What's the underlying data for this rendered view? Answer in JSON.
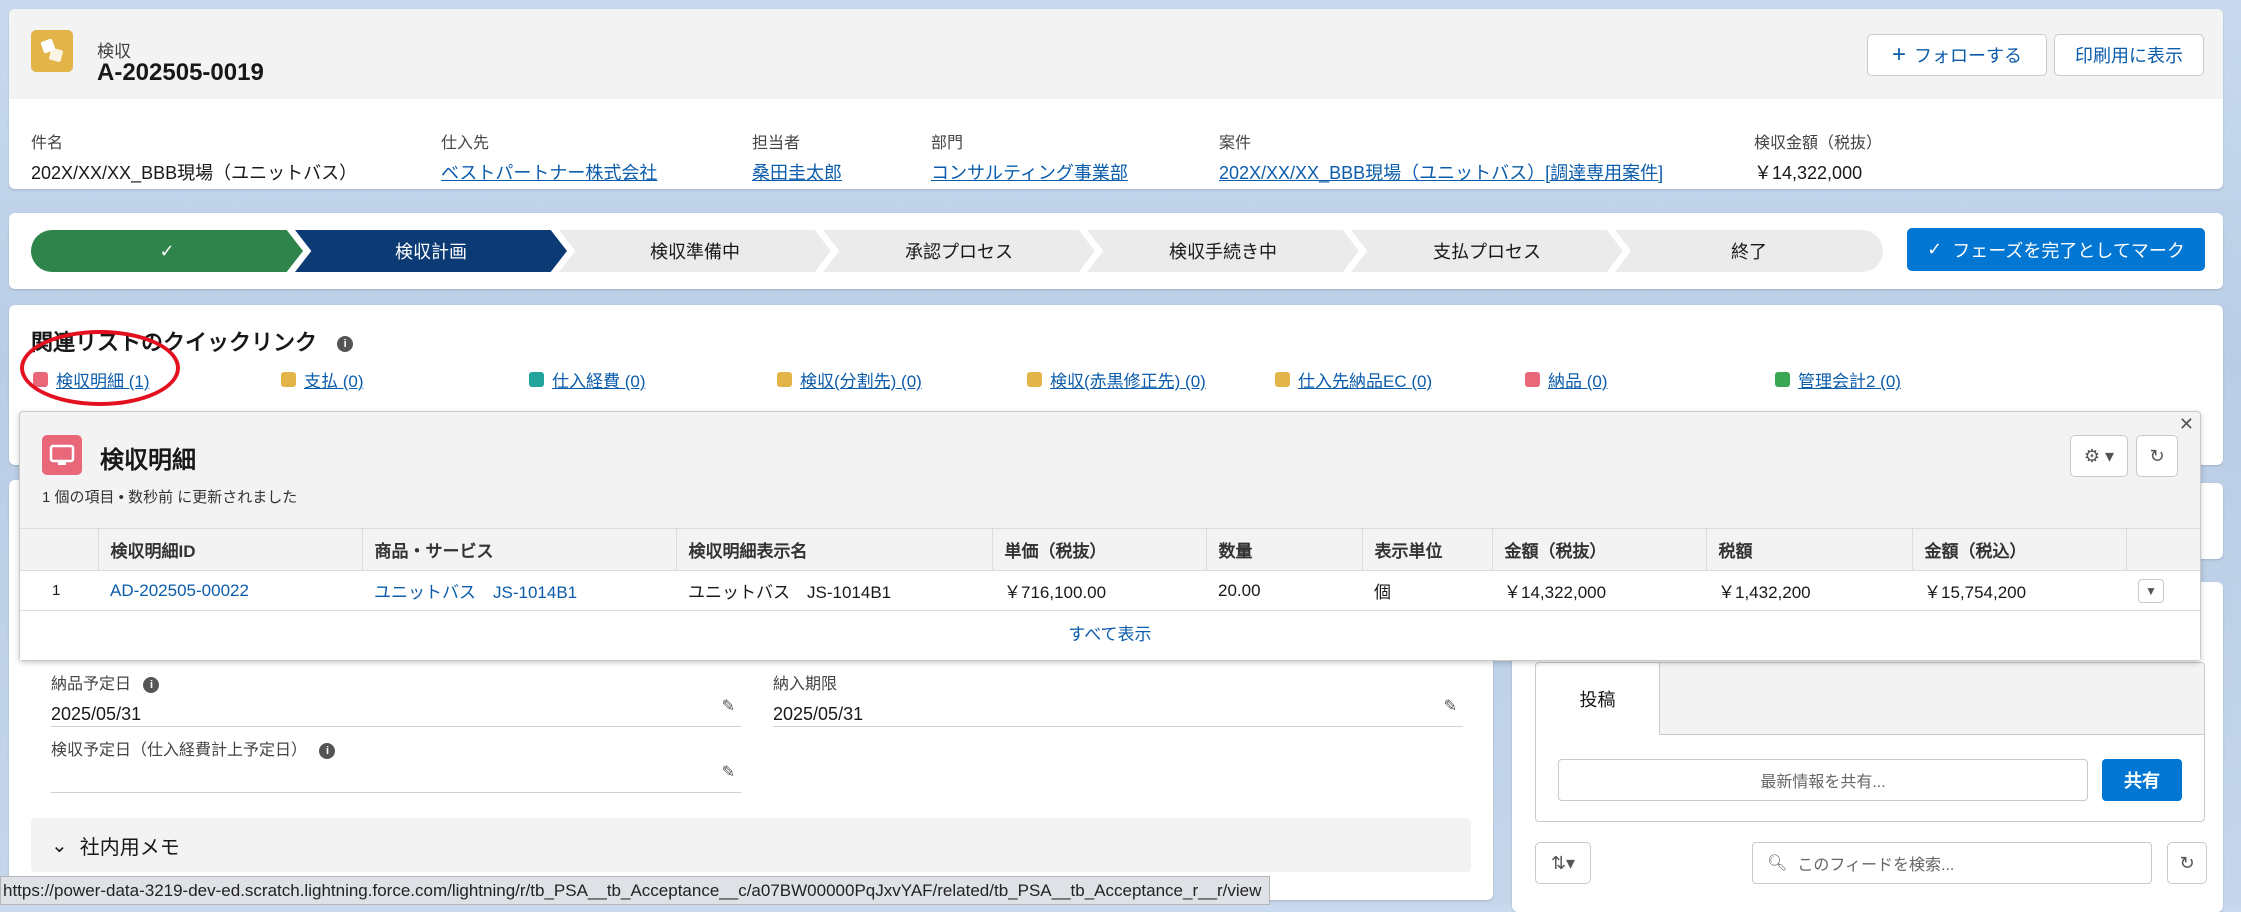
{
  "header": {
    "object_label": "検収",
    "record_name": "A-202505-0019",
    "follow_label": "フォローする",
    "print_label": "印刷用に表示",
    "fields": [
      {
        "label": "件名",
        "value": "202X/XX/XX_BBB現場（ユニットバス）",
        "link": false
      },
      {
        "label": "仕入先",
        "value": "ベストパートナー株式会社",
        "link": true
      },
      {
        "label": "担当者",
        "value": "桑田圭太郎",
        "link": true
      },
      {
        "label": "部門",
        "value": "コンサルティング事業部",
        "link": true
      },
      {
        "label": "案件",
        "value": "202X/XX/XX_BBB現場（ユニットバス）[調達専用案件]",
        "link": true
      },
      {
        "label": "検収金額（税抜）",
        "value": "￥14,322,000",
        "link": false
      }
    ]
  },
  "path": {
    "steps": [
      "✓",
      "検収計画",
      "検収準備中",
      "承認プロセス",
      "検収手続き中",
      "支払プロセス",
      "終了"
    ],
    "mark_label": "フェーズを完了としてマーク"
  },
  "quick_links": {
    "title": "関連リストのクイックリンク",
    "items": [
      {
        "label": "検収明細 (1)",
        "color": "#e8687a"
      },
      {
        "label": "支払 (0)",
        "color": "#e3b447"
      },
      {
        "label": "仕入経費 (0)",
        "color": "#22a39b"
      },
      {
        "label": "検収(分割先) (0)",
        "color": "#e3b447"
      },
      {
        "label": "検収(赤黒修正先) (0)",
        "color": "#e3b447"
      },
      {
        "label": "仕入先納品EC (0)",
        "color": "#e3b447"
      },
      {
        "label": "納品 (0)",
        "color": "#e8687a"
      },
      {
        "label": "管理会計2 (0)",
        "color": "#3ba755"
      }
    ]
  },
  "popover": {
    "title": "検収明細",
    "subtitle": "1 個の項目 • 数秒前 に更新されました",
    "columns": [
      "",
      "検収明細ID",
      "商品・サービス",
      "検収明細表示名",
      "単価（税抜）",
      "数量",
      "表示単位",
      "金額（税抜）",
      "税額",
      "金額（税込）",
      ""
    ],
    "rows": [
      [
        "1",
        "AD-202505-00022",
        "ユニットバス　JS-1014B1",
        "ユニットバス　JS-1014B1",
        "￥716,100.00",
        "20.00",
        "個",
        "￥14,322,000",
        "￥1,432,200",
        "￥15,754,200"
      ]
    ],
    "show_all": "すべて表示"
  },
  "detail": {
    "fields": [
      {
        "label": "納品予定日",
        "value": "2025/05/31"
      },
      {
        "label": "納入期限",
        "value": "2025/05/31"
      },
      {
        "label": "検収予定日（仕入経費計上予定日）",
        "value": ""
      }
    ],
    "memo_section": "社内用メモ"
  },
  "feed": {
    "tab_post": "投稿",
    "share_placeholder": "最新情報を共有...",
    "share_button": "共有",
    "search_placeholder": "このフィードを検索..."
  },
  "status_url": "https://power-data-3219-dev-ed.scratch.lightning.force.com/lightning/r/tb_PSA__tb_Acceptance__c/a07BW00000PqJxvYAF/related/tb_PSA__tb_Acceptance_r__r/view"
}
